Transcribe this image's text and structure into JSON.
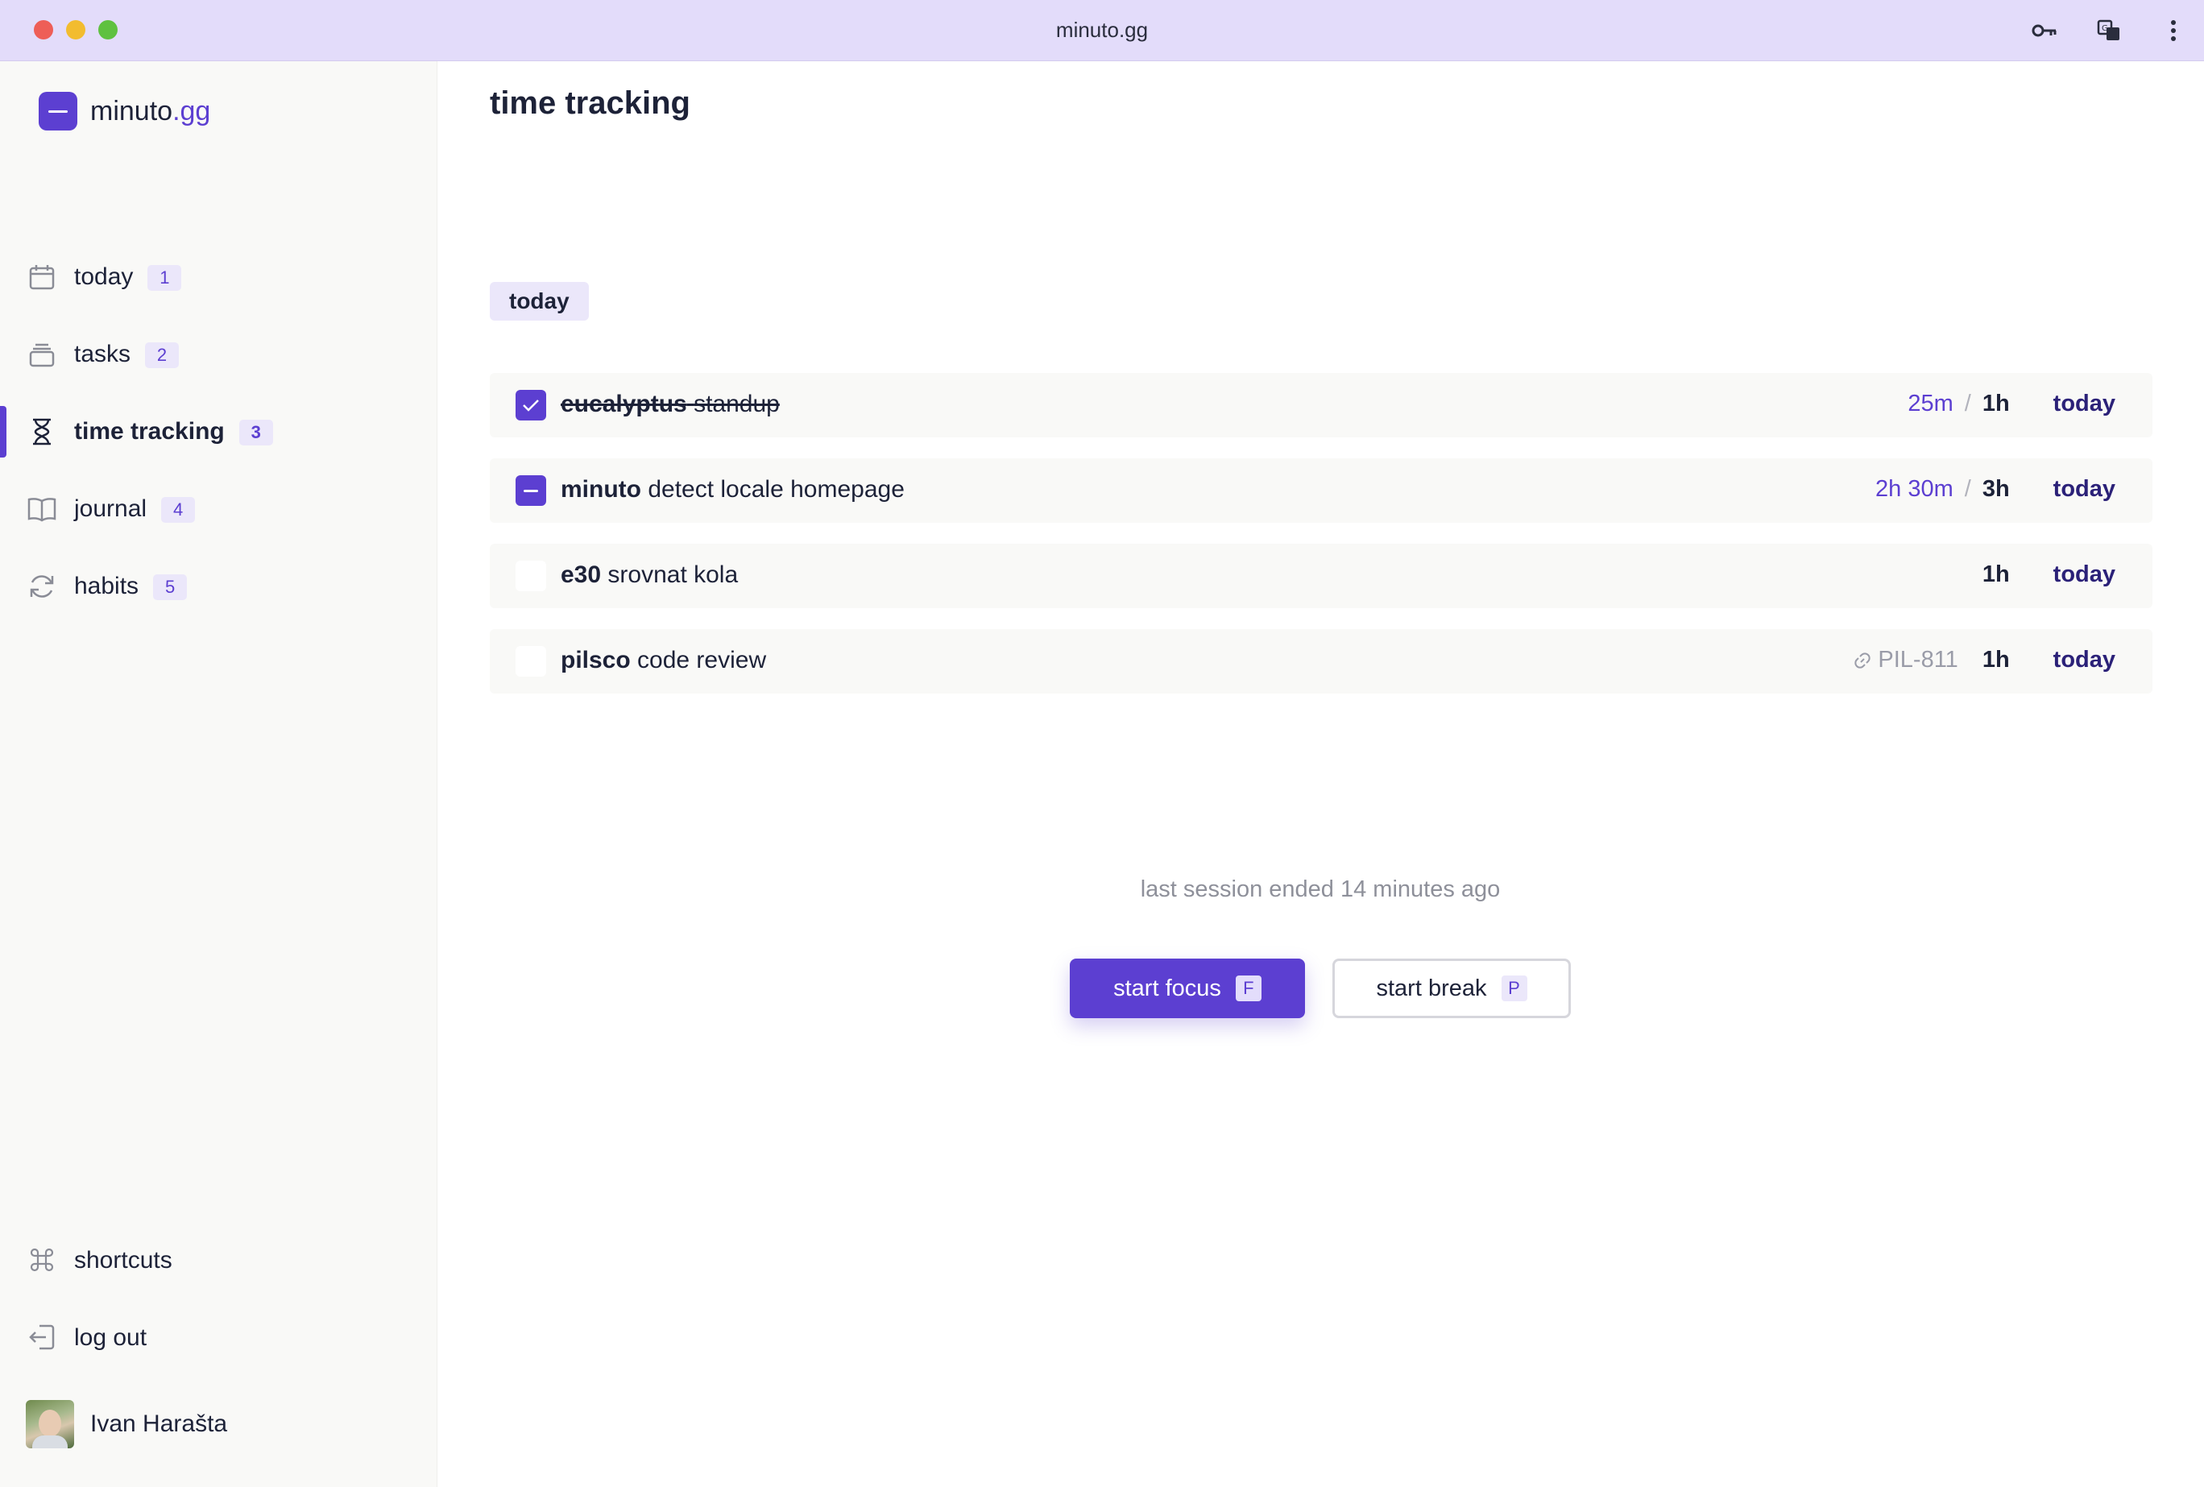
{
  "window": {
    "title": "minuto.gg"
  },
  "brand": {
    "name": "minuto",
    "tld": ".gg"
  },
  "sidebar": {
    "items": [
      {
        "label": "today",
        "badge": "1",
        "icon": "calendar-icon"
      },
      {
        "label": "tasks",
        "badge": "2",
        "icon": "stack-icon"
      },
      {
        "label": "time tracking",
        "badge": "3",
        "icon": "hourglass-icon",
        "active": true
      },
      {
        "label": "journal",
        "badge": "4",
        "icon": "book-icon"
      },
      {
        "label": "habits",
        "badge": "5",
        "icon": "refresh-icon"
      }
    ],
    "bottom": [
      {
        "label": "shortcuts",
        "icon": "command-icon"
      },
      {
        "label": "log out",
        "icon": "logout-icon"
      }
    ],
    "user": {
      "name": "Ivan Harašta"
    }
  },
  "main": {
    "title": "time tracking",
    "section": "today",
    "tasks": [
      {
        "project": "eucalyptus",
        "name": "standup",
        "status": "done",
        "spent": "25m",
        "estimate": "1h",
        "due": "today"
      },
      {
        "project": "minuto",
        "name": "detect locale homepage",
        "status": "in-progress",
        "spent": "2h 30m",
        "estimate": "3h",
        "due": "today"
      },
      {
        "project": "e30",
        "name": "srovnat kola",
        "status": "todo",
        "estimate": "1h",
        "due": "today"
      },
      {
        "project": "pilsco",
        "name": "code review",
        "status": "todo",
        "ticket": "PIL-811",
        "estimate": "1h",
        "due": "today"
      }
    ],
    "slash": "/",
    "session_status": "last session ended 14 minutes ago",
    "buttons": {
      "focus": {
        "label": "start focus",
        "key": "F"
      },
      "break": {
        "label": "start break",
        "key": "P"
      }
    }
  },
  "colors": {
    "accent": "#5c3fd1",
    "titlebar": "#e3dcfa",
    "sidebar": "#f9f9f7"
  }
}
